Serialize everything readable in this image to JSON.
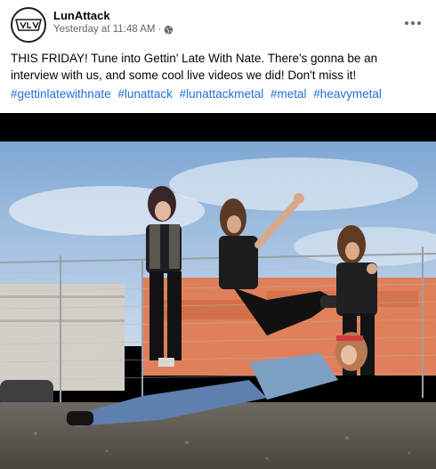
{
  "post": {
    "page_name": "LunAttack",
    "timestamp": "Yesterday at 11:48 AM",
    "separator": "·",
    "audience_icon": "globe-icon",
    "more_icon": "more-options-icon",
    "body": "THIS FRIDAY! Tune into Gettin' Late With Nate. There's gonna be an interview with us, and some cool live videos we did! Don't miss it!",
    "hashtags": [
      "#gettinlatewithnate",
      "#lunattack",
      "#lunattackmetal",
      "#metal",
      "#heavymetal"
    ]
  },
  "colors": {
    "link": "#216fdb",
    "secondary_text": "#65676b",
    "primary_text": "#050505"
  }
}
